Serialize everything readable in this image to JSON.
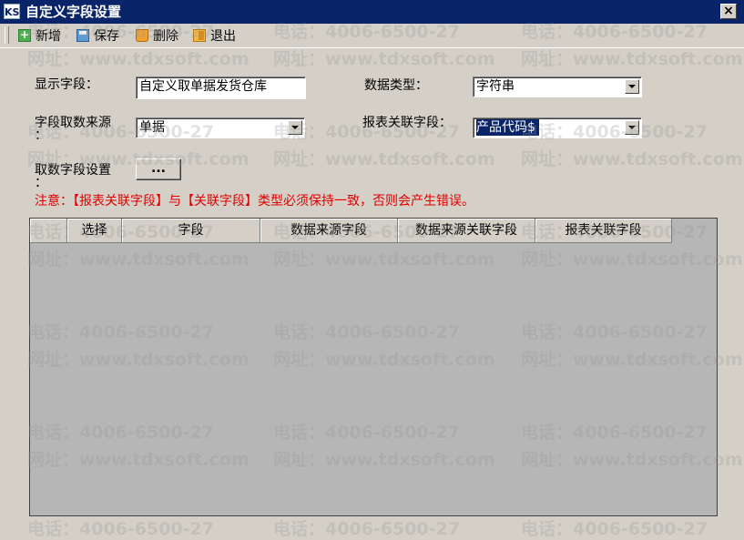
{
  "window": {
    "title": "自定义字段设置",
    "app_icon_text": "KS",
    "close_label": "×"
  },
  "toolbar": {
    "items": [
      {
        "label": "新增",
        "icon": "add-icon"
      },
      {
        "label": "保存",
        "icon": "save-icon"
      },
      {
        "label": "删除",
        "icon": "delete-icon"
      },
      {
        "label": "退出",
        "icon": "exit-icon"
      }
    ]
  },
  "form": {
    "display_field_label": "显示字段：",
    "display_field_value": "自定义取单据发货仓库",
    "data_type_label": "数据类型：",
    "data_type_value": "字符串",
    "source_label_line1": "字段取数来源",
    "source_label_line2": "：",
    "source_value": "单据",
    "report_link_label": "报表关联字段：",
    "report_link_value": "产品代码$",
    "fetch_setting_label_line1": "取数字段设置",
    "fetch_setting_label_line2": "：",
    "fetch_setting_button": "..."
  },
  "notice": "注意：【报表关联字段】与【关联字段】类型必须保持一致，否则会产生错误。",
  "table": {
    "columns": [
      "选择",
      "字段",
      "数据来源字段",
      "数据来源关联字段",
      "报表关联字段"
    ],
    "rows": []
  },
  "watermark": {
    "phone": "电话：4006-6500-27",
    "site": "网址：www.tdxsoft.com"
  },
  "colors": {
    "titlebar": "#0a246a",
    "notice": "#e00000",
    "window_bg": "#d4d0c8",
    "grid_bg": "#b6b6b6",
    "selection": "#0a246a"
  }
}
